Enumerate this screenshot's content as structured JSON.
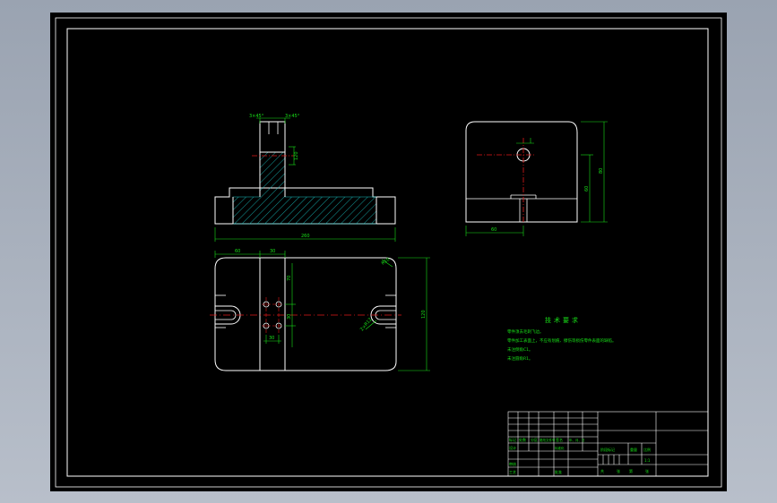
{
  "colors": {
    "background": "#000000",
    "outline": "#ffffff",
    "dimension": "#18e018",
    "centerline": "#e01818",
    "hatch": "#18c0c0",
    "frame_surround": "#a9b1be"
  },
  "drawing": {
    "front_view": {
      "dim_top_left": "3×45°",
      "dim_top_right": "3×45°",
      "dim_height": "120",
      "dim_width": "260"
    },
    "side_view": {
      "dim_bottom": "60",
      "dim_height_inner": "60",
      "dim_height_outer": "80"
    },
    "top_view": {
      "dim_left_a": "60",
      "dim_left_b": "30",
      "dim_hole_pitch": "30",
      "dim_hole_pitch_b": "30",
      "dim_corner": "R10",
      "dim_slot_note": "2×R12",
      "dim_overall_height": "120",
      "dim_top_span": "70"
    }
  },
  "notes": {
    "title": "技术要求",
    "lines": [
      "零件须去毛刺飞边。",
      "零件加工表面上，不应有划痕、擦伤等损伤零件表面的缺陷。",
      "未注倒角C1。",
      "未注圆角R1。"
    ]
  },
  "title_block": {
    "headers": [
      "标记",
      "处数",
      "分区",
      "更改文件号",
      "签名",
      "年、月、日"
    ],
    "design": "设计",
    "standardize": "标准化",
    "review": "审核",
    "process": "工艺",
    "approve": "批准",
    "stage_mark": "阶段标记",
    "weight": "重量",
    "scale": "比例",
    "scale_value": "1:1",
    "sheets_total": "共",
    "sheet_of": "张",
    "sheet_no": "第",
    "sheet_no_suffix": "张"
  }
}
